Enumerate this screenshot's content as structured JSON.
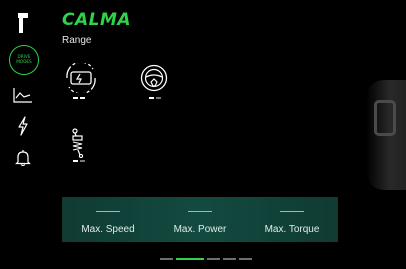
{
  "app": {
    "title": "CALMA",
    "subtitle": "Range"
  },
  "sidebar": {
    "items": [
      {
        "name": "brand-logo",
        "icon": "brand-logo-icon"
      },
      {
        "name": "drive-mode",
        "label_line1": "DRIVE",
        "label_line2": "MODES",
        "icon": "drive-mode-icon",
        "active": true
      },
      {
        "name": "chart",
        "icon": "line-chart-icon"
      },
      {
        "name": "energy",
        "icon": "lightning-icon"
      },
      {
        "name": "notifications",
        "icon": "bell-icon"
      }
    ]
  },
  "modes": {
    "battery": {
      "icon": "battery-recycle-icon",
      "level": "2/2"
    },
    "steering": {
      "icon": "steering-wheel-icon",
      "level": "1/2"
    },
    "suspension": {
      "icon": "suspension-shock-icon",
      "level": "1/2"
    }
  },
  "stats": {
    "max_speed_label": "Max. Speed",
    "max_power_label": "Max. Power",
    "max_torque_label": "Max. Torque"
  },
  "pager": {
    "pages": 5,
    "active_index": 1
  },
  "colors": {
    "accent": "#2fd24a",
    "panel": "#134a40",
    "background": "#000000"
  }
}
